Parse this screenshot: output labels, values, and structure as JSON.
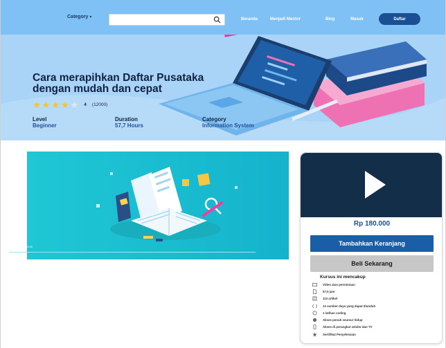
{
  "nav": {
    "category_label": "Category",
    "search_placeholder": "",
    "links": [
      "Beranda",
      "Menjadi Mentor",
      "Blog",
      "Masuk"
    ],
    "register_label": "Daftar"
  },
  "hero": {
    "title": "Cara merapihkan Daftar Pusataka dengan mudah dan cepat",
    "rating": {
      "value": "4",
      "count": "(12000)",
      "stars_filled": 4,
      "stars_total": 5
    },
    "meta": [
      {
        "label": "Level",
        "value": "Beginner"
      },
      {
        "label": "Duration",
        "value": "57,7 Hours"
      },
      {
        "label": "Category",
        "value": "Information System"
      }
    ]
  },
  "video": {
    "time": "0:00 / 4:40"
  },
  "sidebar": {
    "price": "Rp 180.000",
    "cart_label": "Tambahkan Keranjang",
    "buy_label": "Beli Sekarang",
    "includes_title": "Kursus ini mencakup",
    "includes": [
      {
        "icon": "video-icon",
        "text": "Video atas permintaan"
      },
      {
        "icon": "document-icon",
        "text": "57,5 jam"
      },
      {
        "icon": "article-icon",
        "text": "113 artikel"
      },
      {
        "icon": "download-icon",
        "text": "12 sumber daya yang dapat diunduh"
      },
      {
        "icon": "code-icon",
        "text": "1 latihan coding"
      },
      {
        "icon": "infinity-icon",
        "text": "Akses penuh seumur hidup"
      },
      {
        "icon": "mobile-icon",
        "text": "Akses di perangkat seluler dan TV"
      },
      {
        "icon": "certificate-icon",
        "text": "Sertifikat Penyelesaian"
      }
    ]
  },
  "colors": {
    "nav_bg": "#7fc0f5",
    "hero_bg": "#a9d3f7",
    "primary": "#1b5ea8",
    "dark_navy": "#122e49",
    "video_bg": "#1cc5d1",
    "star": "#f4c430"
  }
}
